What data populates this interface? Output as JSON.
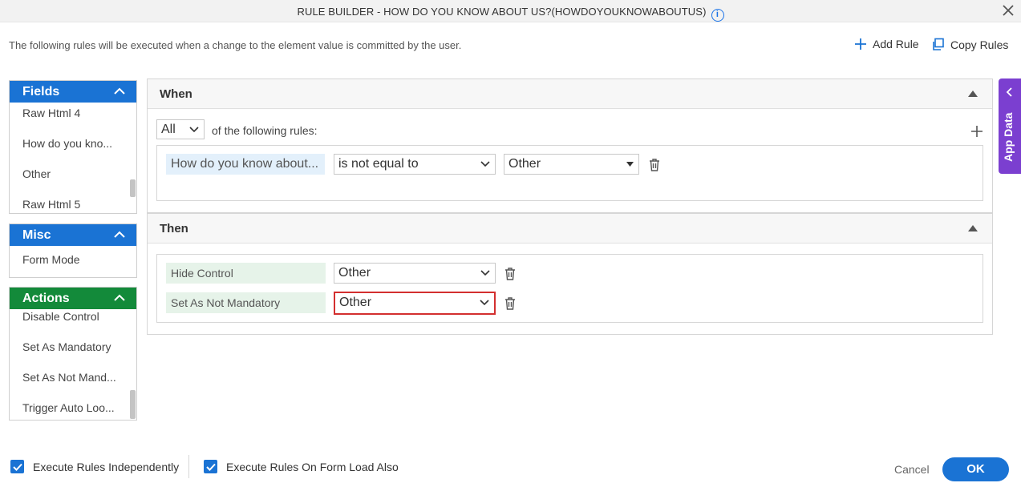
{
  "dialog": {
    "title": "RULE BUILDER - HOW DO YOU KNOW ABOUT US?(HOWDOYOUKNOWABOUTUS)",
    "description": "The following rules will be executed when a change to the element value is committed by the user.",
    "add_rule": "Add Rule",
    "copy_rules": "Copy Rules"
  },
  "fields_panel": {
    "title": "Fields",
    "items": [
      "Raw Html 4",
      "How do you kno...",
      "Other",
      "Raw Html 5"
    ]
  },
  "misc_panel": {
    "title": "Misc",
    "items": [
      "Form Mode"
    ]
  },
  "actions_panel": {
    "title": "Actions",
    "items": [
      "Disable Control",
      "Set As Mandatory",
      "Set As Not Mand...",
      "Trigger Auto Loo..."
    ]
  },
  "when": {
    "title": "When",
    "match_mode": "All",
    "match_suffix": "of the following rules:",
    "condition": {
      "field": "How do you know about...",
      "operator": "is not equal to",
      "value": "Other"
    }
  },
  "then": {
    "title": "Then",
    "actions": [
      {
        "action": "Hide Control",
        "target": "Other"
      },
      {
        "action": "Set As Not Mandatory",
        "target": "Other"
      }
    ]
  },
  "footer": {
    "exec_independently": "Execute Rules Independently",
    "exec_on_load": "Execute Rules On Form Load Also",
    "cancel": "Cancel",
    "ok": "OK"
  },
  "side_tab": {
    "label": "App Data"
  },
  "colors": {
    "primary": "#1a73d4",
    "actions_green": "#138a3a",
    "app_data_purple": "#7b3fd0",
    "error_border": "#d32f2f"
  }
}
